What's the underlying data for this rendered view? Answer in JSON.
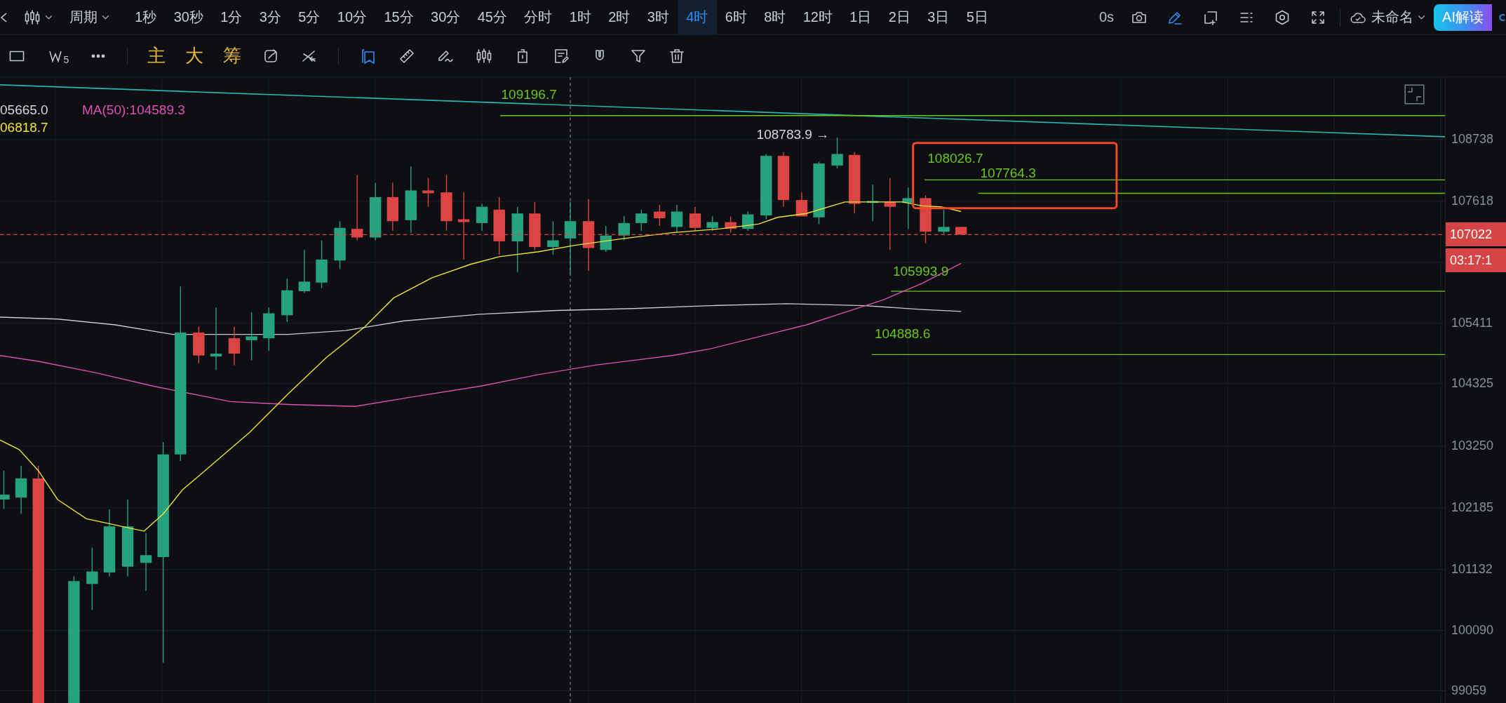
{
  "top_bar": {
    "chart_type_menu": {
      "expanded": false
    },
    "period_menu": {
      "label": "周期",
      "expanded": false
    },
    "intervals": [
      {
        "label": "1秒",
        "selected": false
      },
      {
        "label": "30秒",
        "selected": false
      },
      {
        "label": "1分",
        "selected": false
      },
      {
        "label": "3分",
        "selected": false
      },
      {
        "label": "5分",
        "selected": false
      },
      {
        "label": "10分",
        "selected": false
      },
      {
        "label": "15分",
        "selected": false
      },
      {
        "label": "30分",
        "selected": false
      },
      {
        "label": "45分",
        "selected": false
      },
      {
        "label": "分时",
        "selected": false
      },
      {
        "label": "1时",
        "selected": false
      },
      {
        "label": "2时",
        "selected": false
      },
      {
        "label": "3时",
        "selected": false
      },
      {
        "label": "4时",
        "selected": true
      },
      {
        "label": "6时",
        "selected": false
      },
      {
        "label": "8时",
        "selected": false
      },
      {
        "label": "12时",
        "selected": false
      },
      {
        "label": "1日",
        "selected": false
      },
      {
        "label": "2日",
        "selected": false
      },
      {
        "label": "3日",
        "selected": false
      },
      {
        "label": "5日",
        "selected": false
      }
    ],
    "countdown": "0s",
    "tools": [
      {
        "kind": "camera",
        "selected": false
      },
      {
        "kind": "pencil",
        "selected": true
      },
      {
        "kind": "add-frame",
        "selected": false
      },
      {
        "kind": "list",
        "selected": false
      },
      {
        "kind": "hexagon",
        "selected": false
      },
      {
        "kind": "fullscreen",
        "selected": false
      }
    ],
    "layout_name": "未命名",
    "ai_button": "AI解读"
  },
  "drawing_toolbar": {
    "tools": [
      {
        "kind": "rectangle",
        "selected": false
      },
      {
        "kind": "wave",
        "sub": "5",
        "selected": false
      },
      {
        "kind": "more",
        "selected": false
      },
      {
        "kind": "divider"
      },
      {
        "kind": "text",
        "label": "主",
        "selected": false
      },
      {
        "kind": "text",
        "label": "大",
        "selected": false
      },
      {
        "kind": "text",
        "label": "筹",
        "selected": false
      },
      {
        "kind": "rotate",
        "selected": false
      },
      {
        "kind": "cross",
        "selected": false
      },
      {
        "kind": "divider"
      },
      {
        "kind": "bookmark",
        "selected": true
      },
      {
        "kind": "ruler",
        "selected": false
      },
      {
        "kind": "pen-wave",
        "selected": false
      },
      {
        "kind": "candles",
        "selected": false
      },
      {
        "kind": "container",
        "selected": false
      },
      {
        "kind": "note",
        "selected": false
      },
      {
        "kind": "magnet",
        "selected": false
      },
      {
        "kind": "filter",
        "selected": false
      },
      {
        "kind": "trash",
        "selected": false
      }
    ]
  },
  "chart": {
    "legend": [
      {
        "text": "05665.0",
        "color": "#d6d6d6"
      },
      {
        "text": "MA(50):104589.3",
        "color": "#e04fb8"
      },
      {
        "text": "06818.7",
        "color": "#f2e23a"
      }
    ],
    "high_marker": "108783.9 →",
    "levels": [
      {
        "label": "109196.7"
      },
      {
        "label": "108026.7"
      },
      {
        "label": "107764.3"
      },
      {
        "label": "105993.9"
      },
      {
        "label": "104888.6"
      }
    ],
    "price_axis": [
      "108738",
      "107618",
      "105411",
      "104325",
      "103250",
      "102185",
      "101132",
      "100090",
      "99059"
    ],
    "last_price": "107022",
    "bar_countdown": "03:17:1"
  }
}
